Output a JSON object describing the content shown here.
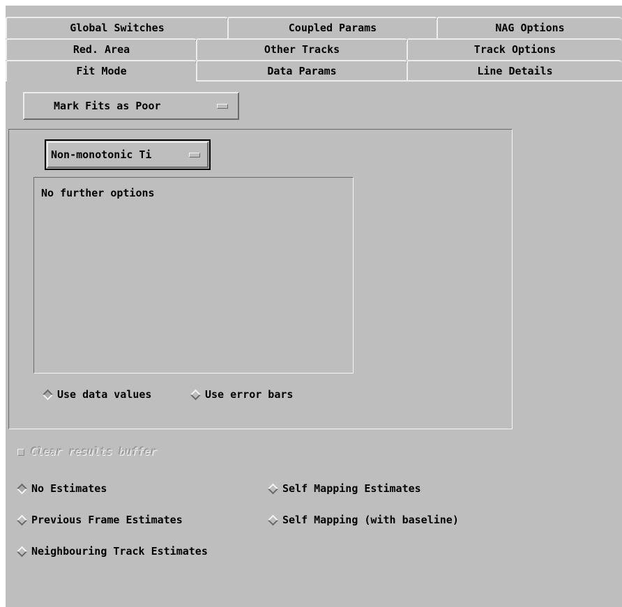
{
  "tabs": {
    "row1": [
      "Global Switches",
      "Coupled Params",
      "NAG Options"
    ],
    "row2": [
      "Red. Area",
      "Other Tracks",
      "Track Options"
    ],
    "row3": [
      "Fit Mode",
      "Data Params",
      "Line Details"
    ]
  },
  "fit_menu": {
    "value": "Mark Fits as Poor"
  },
  "group": {
    "menu_value": "Non-monotonic Ti",
    "options_text": "No further options",
    "radio_data_values": "Use data values",
    "radio_error_bars": "Use error bars"
  },
  "clear_results": {
    "label": "Clear results buffer",
    "checked": false,
    "enabled": false
  },
  "estimates": {
    "no_estimates": "No Estimates",
    "self_mapping": "Self Mapping Estimates",
    "previous_frame": "Previous Frame Estimates",
    "self_mapping_baseline": "Self Mapping (with baseline)",
    "neighbouring_track": "Neighbouring Track Estimates",
    "selected": "No Estimates"
  }
}
